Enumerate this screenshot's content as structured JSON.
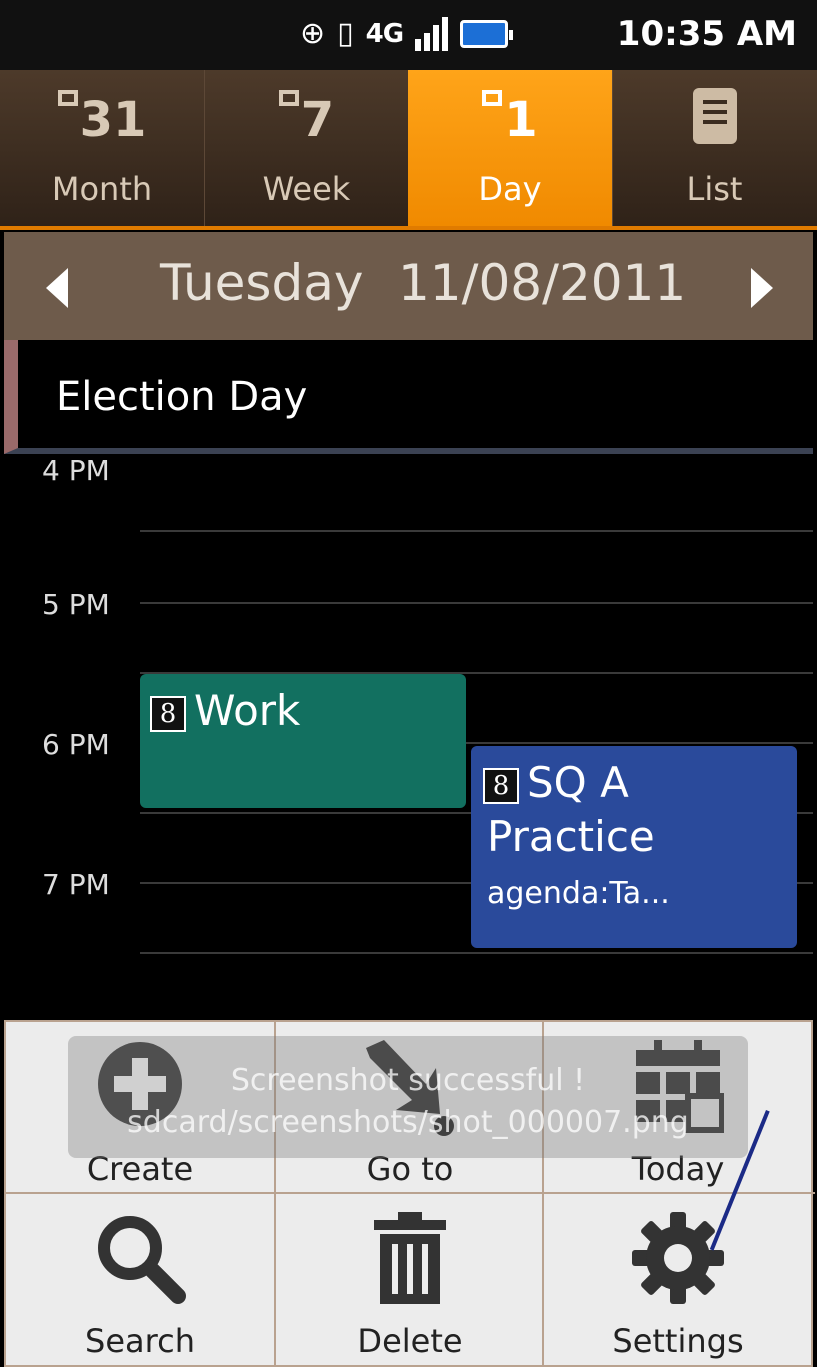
{
  "status_bar": {
    "clock": "10:35 AM",
    "network": "4G",
    "icons": [
      "gps-icon",
      "vibrate-icon",
      "4g-lte-icon",
      "signal-icon",
      "battery-icon"
    ]
  },
  "tabs": [
    {
      "label": "Month",
      "icon_number": "31",
      "active": false
    },
    {
      "label": "Week",
      "icon_number": "7",
      "active": false
    },
    {
      "label": "Day",
      "icon_number": "1",
      "active": true
    },
    {
      "label": "List",
      "icon": "list-icon",
      "active": false
    }
  ],
  "datebar": {
    "day_name": "Tuesday",
    "date": "11/08/2011"
  },
  "all_day_event": "Election Day",
  "hours": [
    "4 PM",
    "5 PM",
    "6 PM",
    "7 PM"
  ],
  "events": [
    {
      "title": "Work",
      "color": "#127060"
    },
    {
      "title_line1": "SQ A",
      "title_line2": "Practice",
      "location": "agenda:Ta...",
      "color": "#2a4a9b"
    }
  ],
  "menu": {
    "create": "Create",
    "goto": "Go to",
    "today": "Today",
    "search": "Search",
    "delete": "Delete",
    "settings": "Settings"
  },
  "toast": {
    "line1": "Screenshot successful !",
    "line2": "sdcard/screenshots/shot_000007.png"
  },
  "colors": {
    "accent": "#f08a00",
    "tab_bg": "#3f2f22",
    "datebar_bg": "#6e5b4b"
  }
}
